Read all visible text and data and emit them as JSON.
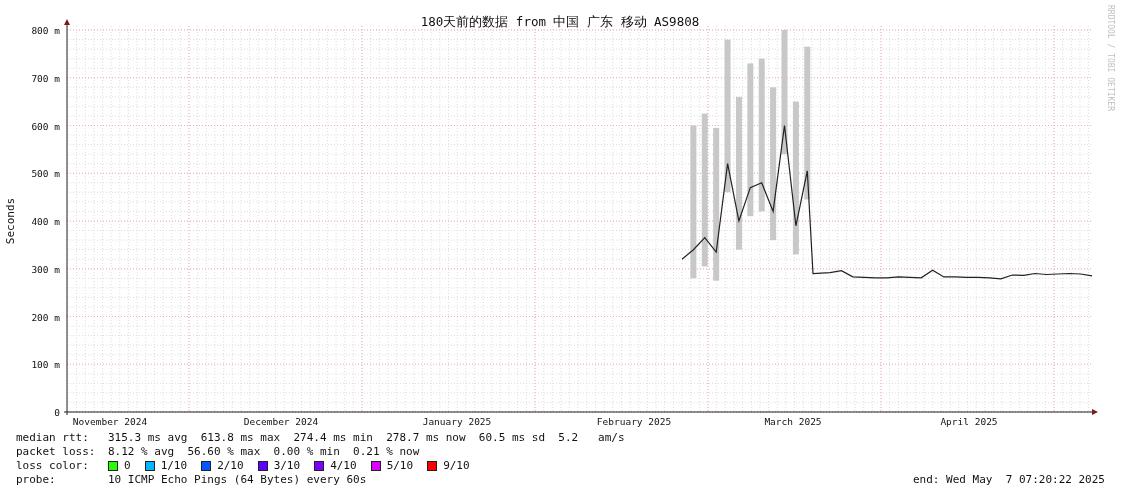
{
  "chart": {
    "title": "180天前的数据 from 中国 广东 移动 AS9808",
    "watermark": "RRDTOOL / TOBI OETIKER",
    "ylabel": "Seconds",
    "y_axis_labels": [
      "800 m",
      "700 m",
      "600 m",
      "500 m",
      "400 m",
      "300 m",
      "200 m",
      "100 m",
      "0"
    ],
    "x_axis_labels": [
      "November 2024",
      "December 2024",
      "January 2025",
      "February 2025",
      "March 2025",
      "April 2025"
    ]
  },
  "stats": [
    {
      "label": "median rtt:",
      "text": "315.3 ms avg  613.8 ms max  274.4 ms min  278.7 ms now  60.5 ms sd  5.2   am/s"
    },
    {
      "label": "packet loss:",
      "text": "8.12 % avg  56.60 % max  0.00 % min  0.21 % now"
    }
  ],
  "loss_color": {
    "label": "loss color:",
    "items": [
      {
        "label": "0",
        "color": "#26ff00"
      },
      {
        "label": "1/10",
        "color": "#00b8ff"
      },
      {
        "label": "2/10",
        "color": "#0059ff"
      },
      {
        "label": "3/10",
        "color": "#5e00ff"
      },
      {
        "label": "4/10",
        "color": "#7e00ff"
      },
      {
        "label": "5/10",
        "color": "#dd00ff"
      },
      {
        "label": "9/10",
        "color": "#ff0000"
      }
    ]
  },
  "probe": {
    "label": "probe:",
    "text": "10 ICMP Echo Pings (64 Bytes) every 60s",
    "end": "end: Wed May  7 07:20:22 2025"
  }
}
